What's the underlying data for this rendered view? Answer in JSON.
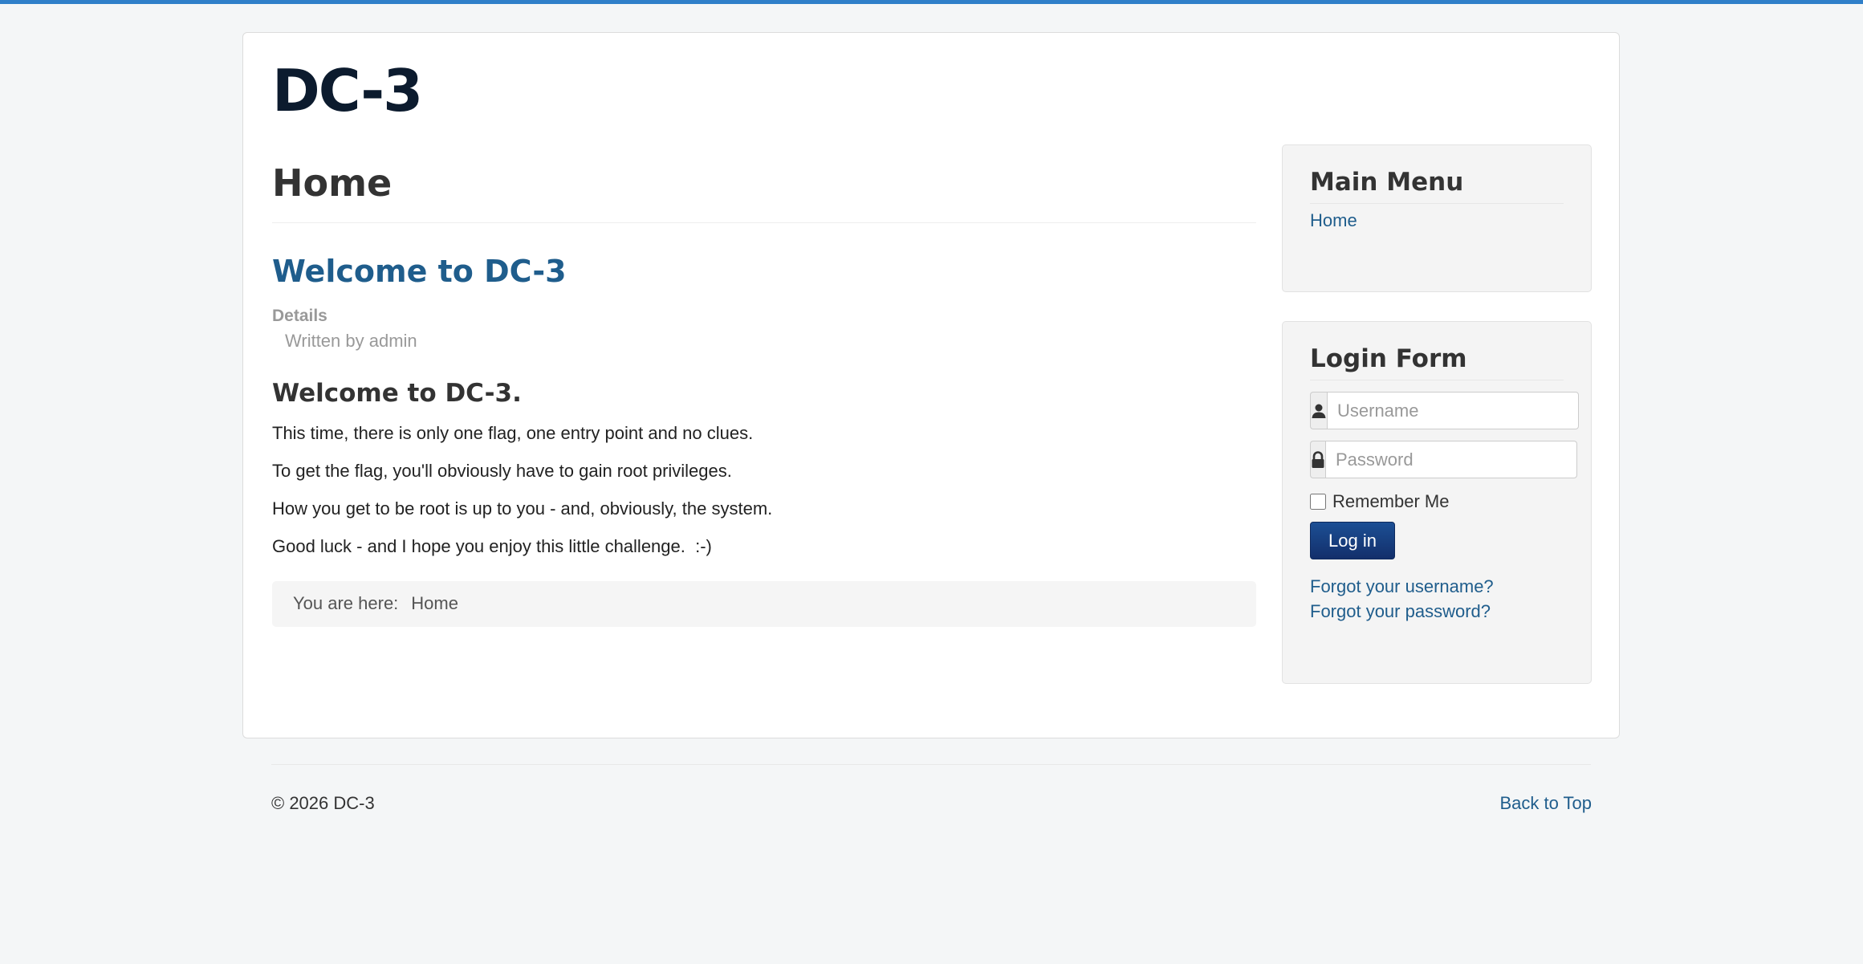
{
  "site": {
    "title": "DC-3"
  },
  "main": {
    "page_heading": "Home",
    "article": {
      "title": "Welcome to DC-3",
      "details_label": "Details",
      "author": "Written by admin",
      "heading": "Welcome to DC-3.",
      "paragraphs": [
        "This time, there is only one flag, one entry point and no clues.",
        "To get the flag, you'll obviously have to gain root privileges.",
        "How you get to be root is up to you - and, obviously, the system.",
        "Good luck - and I hope you enjoy this little challenge.  :-)"
      ]
    },
    "breadcrumb": {
      "prefix": "You are here:",
      "current": "Home"
    }
  },
  "sidebar": {
    "main_menu": {
      "title": "Main Menu",
      "items": [
        {
          "label": "Home"
        }
      ]
    },
    "login": {
      "title": "Login Form",
      "username_placeholder": "Username",
      "password_placeholder": "Password",
      "remember_label": "Remember Me",
      "submit_label": "Log in",
      "forgot_username": "Forgot your username?",
      "forgot_password": "Forgot your password?",
      "user_icon": "user-icon",
      "lock_icon": "lock-icon"
    }
  },
  "footer": {
    "copyright": "© 2026 DC-3",
    "back_to_top": "Back to Top"
  },
  "colors": {
    "accent_bar": "#2f7fc9",
    "link": "#1f5d8c",
    "button": "#132f6b",
    "title": "#0c1b2e"
  }
}
